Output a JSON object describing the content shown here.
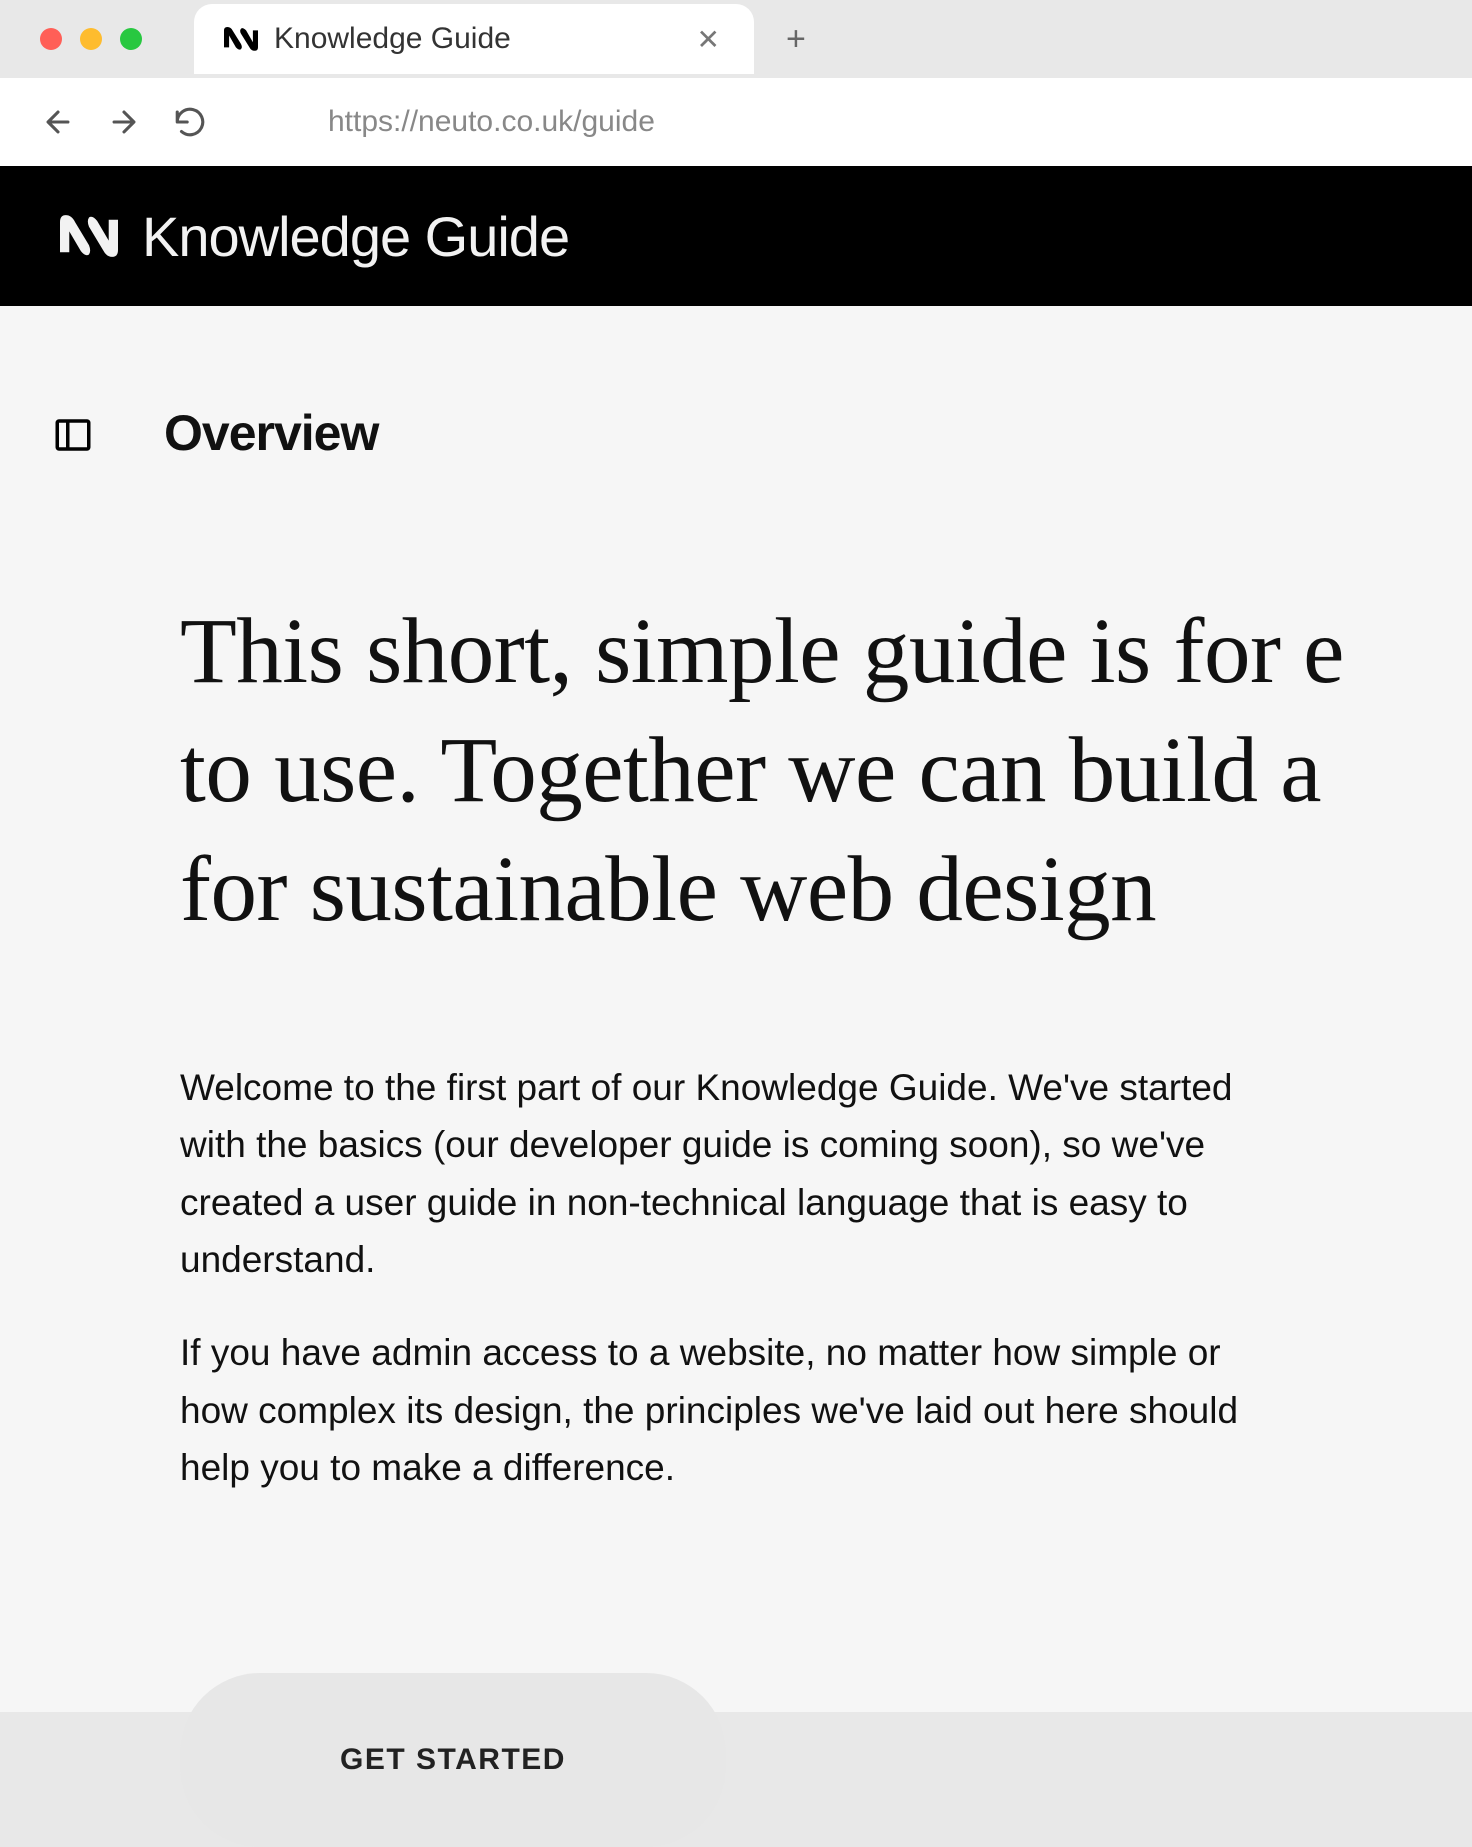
{
  "browser": {
    "tab": {
      "title": "Knowledge Guide"
    },
    "url": "https://neuto.co.uk/guide"
  },
  "header": {
    "title": "Knowledge Guide"
  },
  "content": {
    "section_title": "Overview",
    "hero_line1": "This short, simple guide is for e",
    "hero_line2": "to use. Together we can build a",
    "hero_line3": "for sustainable web design",
    "paragraph1": "Welcome to the first part of our Knowledge Guide. We've started with the basics (our developer guide is coming soon), so we've created a user guide in non-technical language that is easy to understand.",
    "paragraph2": "If you have admin access to a website, no matter how simple or how complex its design, the principles we've laid out here should help you to make a difference.",
    "cta_label": "GET STARTED"
  }
}
